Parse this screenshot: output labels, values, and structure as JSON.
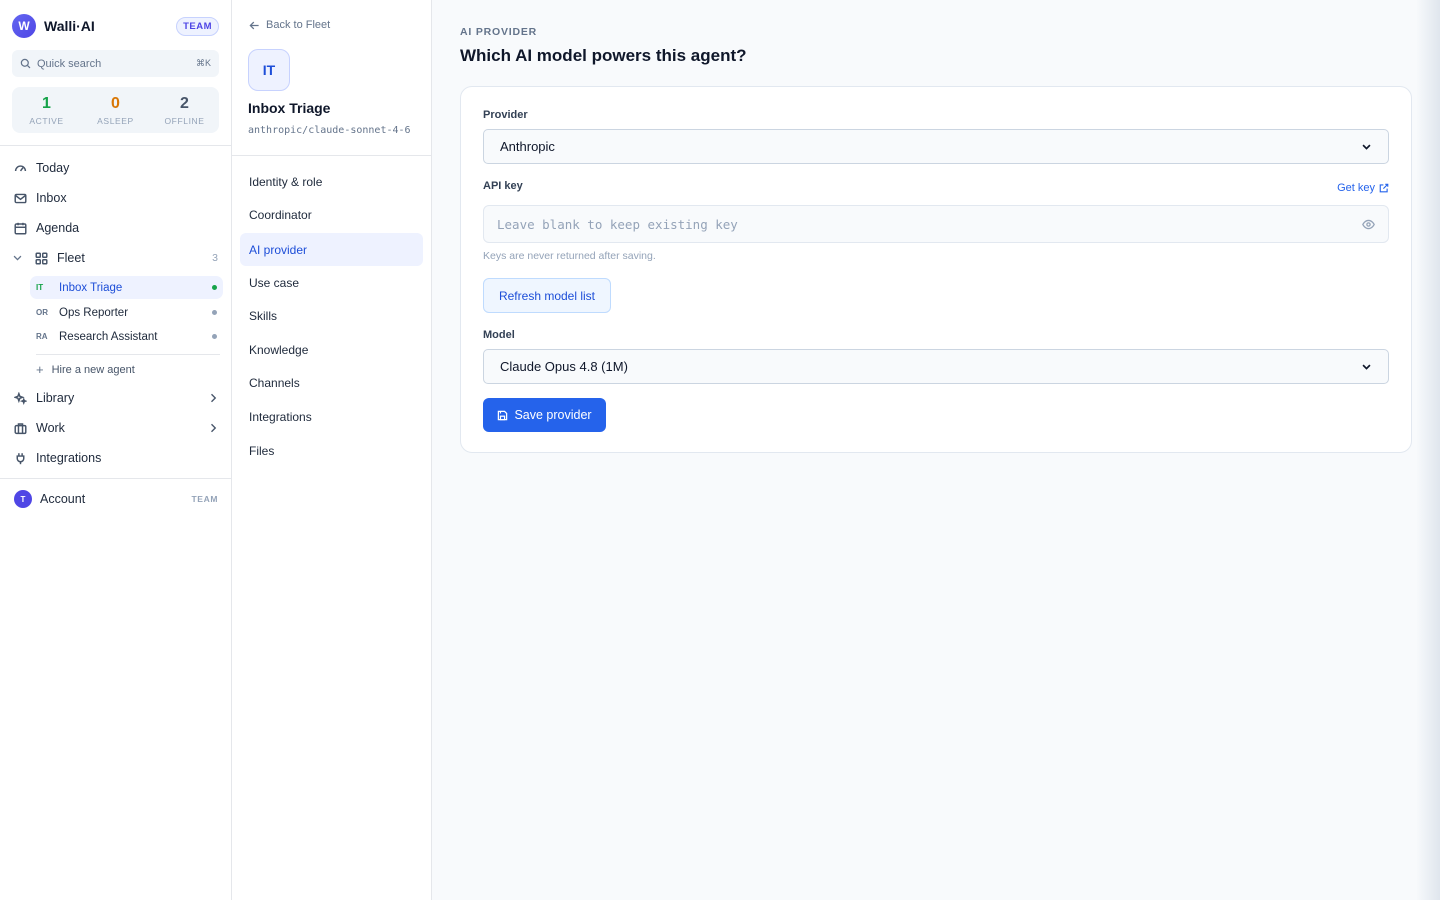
{
  "brand": {
    "logo_letter": "W",
    "name": "Walli·AI",
    "badge": "TEAM"
  },
  "search": {
    "placeholder": "Quick search",
    "shortcut": "⌘K"
  },
  "stats": [
    {
      "value": "1",
      "label": "ACTIVE",
      "color": "#16a34a"
    },
    {
      "value": "0",
      "label": "ASLEEP",
      "color": "#d97706"
    },
    {
      "value": "2",
      "label": "OFFLINE",
      "color": "#475569"
    }
  ],
  "nav": {
    "today": "Today",
    "inbox": "Inbox",
    "agenda": "Agenda",
    "fleet": "Fleet",
    "fleet_count": "3",
    "library": "Library",
    "work": "Work",
    "integrations": "Integrations"
  },
  "agents": [
    {
      "initials": "IT",
      "name": "Inbox Triage",
      "status": "active"
    },
    {
      "initials": "OR",
      "name": "Ops Reporter",
      "status": "offline"
    },
    {
      "initials": "RA",
      "name": "Research Assistant",
      "status": "offline"
    }
  ],
  "hire_label": "Hire a new agent",
  "account": {
    "avatar": "T",
    "label": "Account",
    "badge": "TEAM"
  },
  "panel": {
    "back_label": "Back to Fleet",
    "avatar": "IT",
    "agent_name": "Inbox Triage",
    "agent_model": "anthropic/claude-sonnet-4-6",
    "tabs": [
      "Identity & role",
      "Coordinator",
      "AI provider",
      "Use case",
      "Skills",
      "Knowledge",
      "Channels",
      "Integrations",
      "Files"
    ],
    "active_tab": "AI provider"
  },
  "main": {
    "eyebrow": "AI PROVIDER",
    "heading": "Which AI model powers this agent?",
    "provider_label": "Provider",
    "provider_value": "Anthropic",
    "api_key_label": "API key",
    "get_key_label": "Get key",
    "api_key_placeholder": "Leave blank to keep existing key",
    "api_key_hint": "Keys are never returned after saving.",
    "refresh_label": "Refresh model list",
    "model_label": "Model",
    "model_value": "Claude Opus 4.8 (1M)",
    "save_label": "Save provider"
  },
  "colors": {
    "accent": "#2563eb",
    "active_bg": "#eef2ff",
    "brand": "#4f46e5"
  }
}
